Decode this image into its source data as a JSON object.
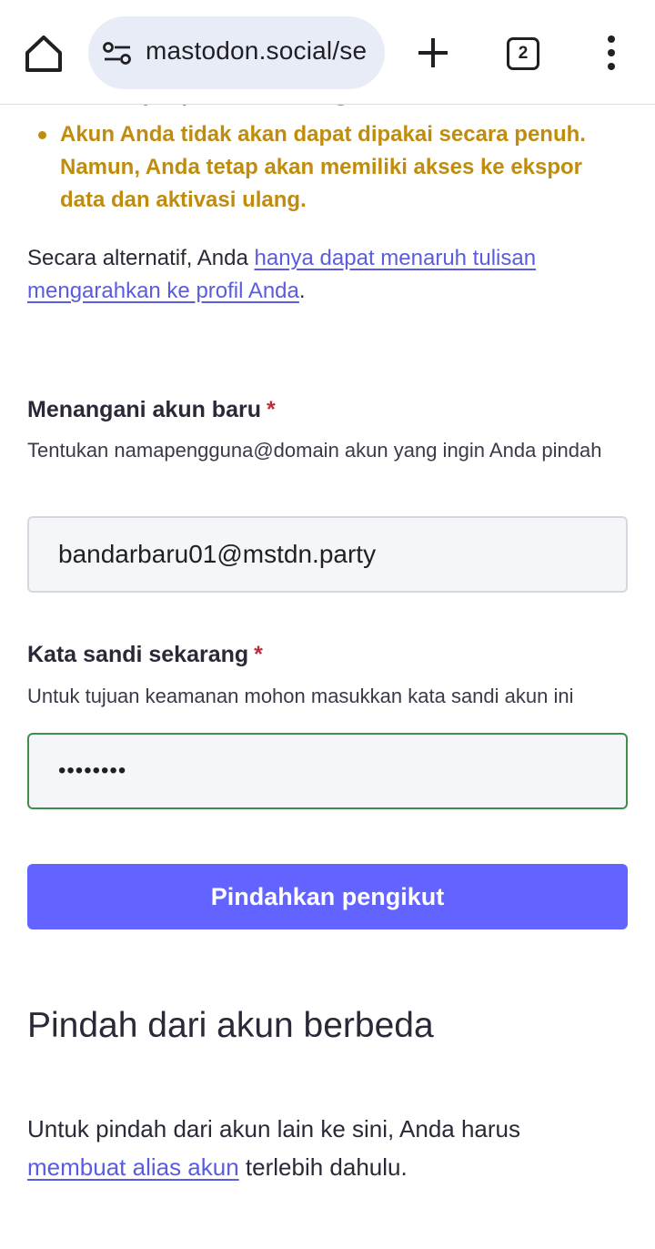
{
  "browser": {
    "url": "mastodon.social/se",
    "tab_count": "2"
  },
  "warning": {
    "partial_line": "tidak dapat pindah akun lagi.",
    "item_text": "Akun Anda tidak akan dapat dipakai secara penuh. Namun, Anda tetap akan memiliki akses ke ekspor data dan aktivasi ulang."
  },
  "alternative": {
    "prefix": "Secara alternatif, Anda ",
    "link_text": "hanya dapat menaruh tulisan mengarahkan ke profil Anda",
    "suffix": "."
  },
  "new_account": {
    "label": "Menangani akun baru",
    "required_mark": "*",
    "hint": "Tentukan namapengguna@domain akun yang ingin Anda pindah",
    "value": "bandarbaru01@mstdn.party"
  },
  "password": {
    "label": "Kata sandi sekarang",
    "required_mark": "*",
    "hint": "Untuk tujuan keamanan mohon masukkan kata sandi akun ini",
    "masked_value": "••••••••"
  },
  "submit_label": "Pindahkan pengikut",
  "move_from": {
    "heading": "Pindah dari akun berbeda",
    "prefix": "Untuk pindah dari akun lain ke sini, Anda harus ",
    "link_text": "membuat alias akun",
    "suffix": " terlebih dahulu."
  }
}
